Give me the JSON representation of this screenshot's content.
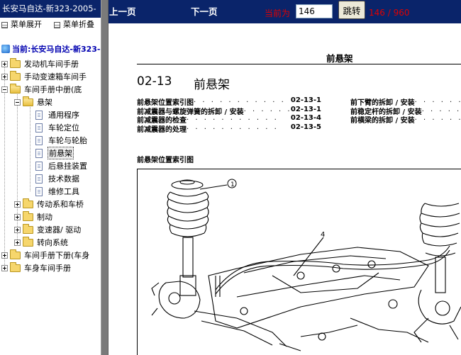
{
  "left_panel": {
    "title": "长安马自达-新323-2005-",
    "toolbar": {
      "expand_label": "菜单展开",
      "collapse_label": "菜单折叠"
    },
    "root_label": "当前:长安马自达-新323-",
    "tree": [
      {
        "label": "发动机车间手册",
        "type": "folder",
        "expander": "plus"
      },
      {
        "label": "手动变速箱车间手",
        "type": "folder",
        "expander": "plus"
      },
      {
        "label": "车间手册中册(底",
        "type": "folder",
        "expander": "minus"
      },
      {
        "label": "悬架",
        "type": "folder",
        "expander": "minus"
      },
      {
        "label": "通用程序",
        "type": "page"
      },
      {
        "label": "车轮定位",
        "type": "page"
      },
      {
        "label": "车轮与轮胎",
        "type": "page"
      },
      {
        "label": "前悬架",
        "type": "page",
        "selected": true
      },
      {
        "label": "后悬挂装置",
        "type": "page"
      },
      {
        "label": "技术数据",
        "type": "page"
      },
      {
        "label": "维修工具",
        "type": "page"
      },
      {
        "label": "传动系和车桥",
        "type": "folder",
        "expander": "plus"
      },
      {
        "label": "制动",
        "type": "folder",
        "expander": "plus"
      },
      {
        "label": "变速器/ 驱动",
        "type": "folder",
        "expander": "plus"
      },
      {
        "label": "转向系统",
        "type": "folder",
        "expander": "plus"
      },
      {
        "label": "车间手册下册(车身",
        "type": "folder",
        "expander": "plus"
      },
      {
        "label": "车身车间手册",
        "type": "folder",
        "expander": "plus"
      }
    ]
  },
  "topbar": {
    "prev_label": "上一页",
    "next_label": "下一页",
    "current_label": "当前为",
    "page_value": "146",
    "jump_label": "跳转",
    "page_count": "146 / 960"
  },
  "document": {
    "header": "前悬架",
    "section_number": "02-13",
    "section_title": "前悬架",
    "toc_left": [
      {
        "title": "前悬架位置索引图",
        "page": "02-13-1"
      },
      {
        "title": "前减震器与螺旋弹簧的拆卸 / 安装",
        "page": "02-13-1"
      },
      {
        "title": "前减震器的检查",
        "page": "02-13-4"
      },
      {
        "title": "前减震器的处理",
        "page": "02-13-5"
      }
    ],
    "toc_right": [
      {
        "title": "前下臂的拆卸 / 安装"
      },
      {
        "title": "前稳定杆的拆卸 / 安装"
      },
      {
        "title": "前横梁的拆卸 / 安装"
      }
    ],
    "figure_caption": "前悬架位置索引图",
    "callouts": [
      "1",
      "4"
    ]
  },
  "colors": {
    "title_bar": "#0a246a",
    "splitter": "#7a7a7a",
    "accent_red": "#e00000",
    "root_label": "#0000b0"
  }
}
